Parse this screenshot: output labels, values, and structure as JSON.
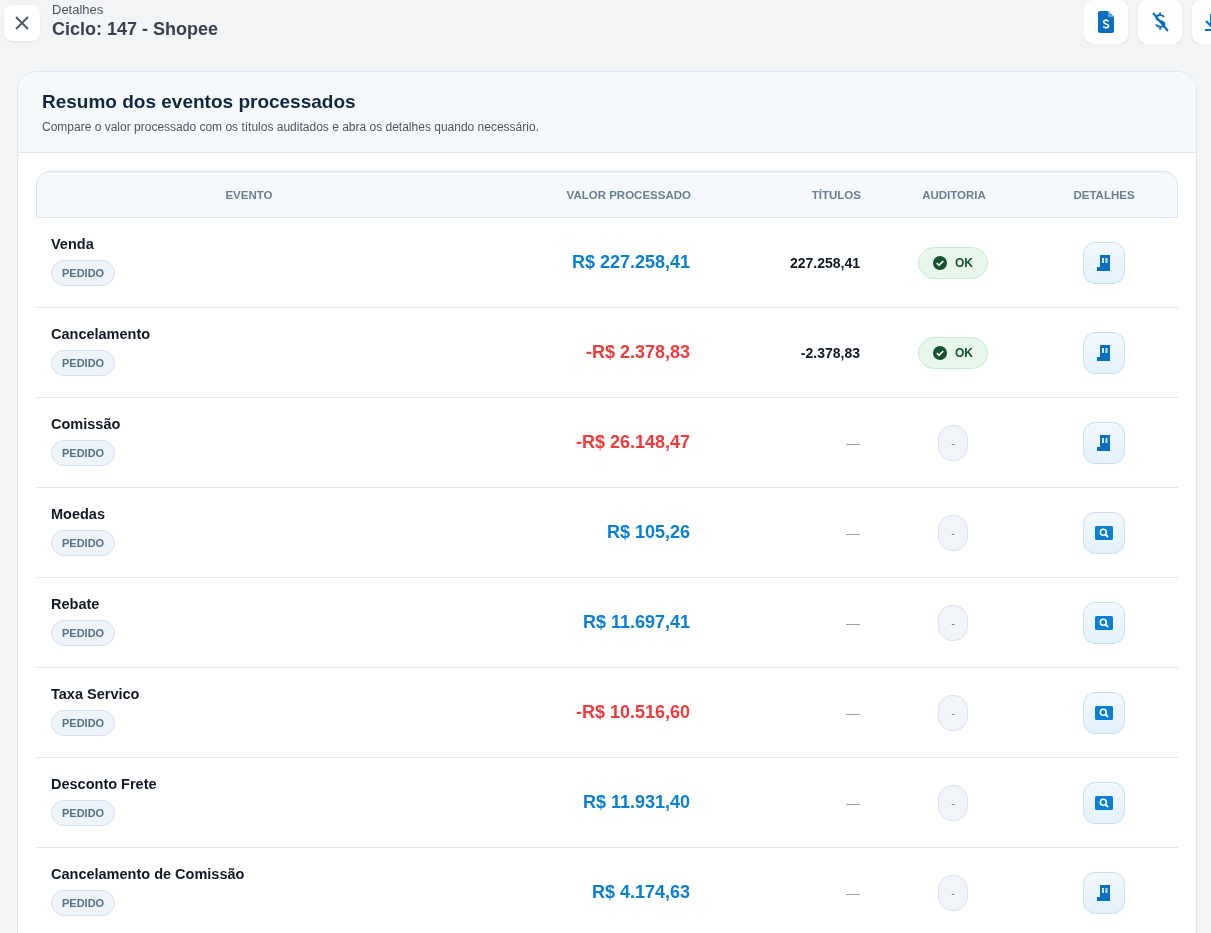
{
  "header": {
    "subtitle": "Detalhes",
    "title": "Ciclo: 147 - Shopee"
  },
  "card": {
    "title": "Resumo dos eventos processados",
    "description": "Compare o valor processado com os títulos auditados e abra os detalhes quando necessário."
  },
  "table": {
    "columns": [
      "EVENTO",
      "VALOR PROCESSADO",
      "TÍTULOS",
      "AUDITORIA",
      "DETALHES"
    ],
    "rows": [
      {
        "evento": "Venda",
        "tag": "PEDIDO",
        "valor": "R$ 227.258,41",
        "negative": false,
        "titulos": "227.258,41",
        "auditoria": {
          "kind": "ok",
          "label": "OK"
        },
        "detalhes": {
          "kind": "receipt"
        }
      },
      {
        "evento": "Cancelamento",
        "tag": "PEDIDO",
        "valor": "-R$ 2.378,83",
        "negative": true,
        "titulos": "-2.378,83",
        "auditoria": {
          "kind": "ok",
          "label": "OK"
        },
        "detalhes": {
          "kind": "receipt"
        }
      },
      {
        "evento": "Comissão",
        "tag": "PEDIDO",
        "valor": "-R$ 26.148,47",
        "negative": true,
        "titulos": "—",
        "auditoria": {
          "kind": "none",
          "label": "-"
        },
        "detalhes": {
          "kind": "receipt"
        }
      },
      {
        "evento": "Moedas",
        "tag": "PEDIDO",
        "valor": "R$ 105,26",
        "negative": false,
        "titulos": "—",
        "auditoria": {
          "kind": "none",
          "label": "-"
        },
        "detalhes": {
          "kind": "search"
        }
      },
      {
        "evento": "Rebate",
        "tag": "PEDIDO",
        "valor": "R$ 11.697,41",
        "negative": false,
        "titulos": "—",
        "auditoria": {
          "kind": "none",
          "label": "-"
        },
        "detalhes": {
          "kind": "search"
        }
      },
      {
        "evento": "Taxa Servico",
        "tag": "PEDIDO",
        "valor": "-R$ 10.516,60",
        "negative": true,
        "titulos": "—",
        "auditoria": {
          "kind": "none",
          "label": "-"
        },
        "detalhes": {
          "kind": "search"
        }
      },
      {
        "evento": "Desconto Frete",
        "tag": "PEDIDO",
        "valor": "R$ 11.931,40",
        "negative": false,
        "titulos": "—",
        "auditoria": {
          "kind": "none",
          "label": "-"
        },
        "detalhes": {
          "kind": "search"
        }
      },
      {
        "evento": "Cancelamento de Comissão",
        "tag": "PEDIDO",
        "valor": "R$ 4.174,63",
        "negative": false,
        "titulos": "—",
        "auditoria": {
          "kind": "none",
          "label": "-"
        },
        "detalhes": {
          "kind": "receipt"
        }
      }
    ]
  }
}
